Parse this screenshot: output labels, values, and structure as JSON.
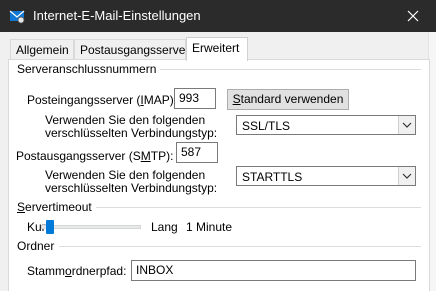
{
  "window": {
    "title": "Internet-E-Mail-Einstellungen"
  },
  "tabs": [
    {
      "label": "Allgemein",
      "active": false
    },
    {
      "label": "Postausgangsserver",
      "active": false
    },
    {
      "label": "Erweitert",
      "active": true
    }
  ],
  "server_ports": {
    "group_label": "Serveranschlussnummern",
    "imap": {
      "label_prefix": "Posteingangsserver (",
      "label_accel": "I",
      "label_suffix": "MAP):",
      "value": "993"
    },
    "default_button": {
      "accel": "S",
      "rest": "tandard verwenden"
    },
    "imap_encryption": {
      "label_line1": "Verwenden Sie den folgenden",
      "label_line2": "verschlüsselten Verbindungstyp:",
      "selected": "SSL/TLS"
    },
    "smtp": {
      "label_prefix": "Postausgangsserver (S",
      "label_accel": "M",
      "label_suffix": "TP):",
      "value": "587"
    },
    "smtp_encryption": {
      "label_line1": "Verwenden Sie den folgenden",
      "label_line2": "verschlüsselten Verbindungstyp:",
      "selected": "STARTTLS"
    }
  },
  "timeout": {
    "group_label_accel": "S",
    "group_label_rest": "ervertimeout",
    "short_label": "Kurz",
    "long_label": "Lang",
    "value_text": "1 Minute",
    "level": 0.05
  },
  "folders": {
    "group_label": "Ordner",
    "root_label_prefix": "Stamm",
    "root_label_accel": "o",
    "root_label_suffix": "rdnerpfad:",
    "root_value": "INBOX"
  },
  "colors": {
    "titlebar": "#2b2b2b",
    "accent": "#007ad9",
    "app_icon": "#0f78d4"
  },
  "icons": {
    "app": "mail-settings-icon",
    "close": "close-icon",
    "dropdown": "chevron-down-icon"
  }
}
